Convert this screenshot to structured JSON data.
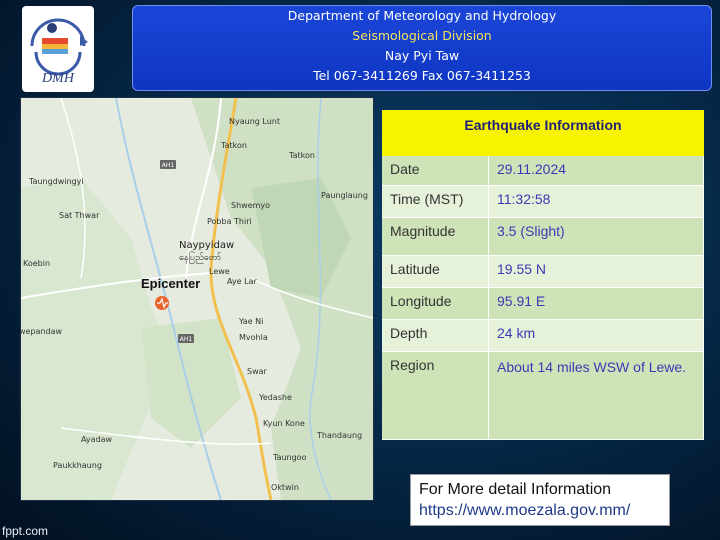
{
  "header": {
    "line1": "Department of Meteorology and Hydrology",
    "line2": "Seismological Division",
    "line3": "Nay Pyi Taw",
    "line4": "Tel 067-3411269 Fax 067-3411253"
  },
  "logo": {
    "text": "DMH"
  },
  "map": {
    "epicenter_label": "Epicenter",
    "places": [
      "Nyaung Lunt",
      "Tatkon",
      "Shwemyo",
      "Tatkon",
      "Paunglaung",
      "Taungdwingyi",
      "Sat Thwar",
      "Pobba Thiri",
      "Naypyidaw",
      "နေပြည်တော်",
      "Lewe",
      "Aye Lar",
      "Koebin",
      "Yae Ni",
      "Mvohla",
      "Swar",
      "Yedashe",
      "Kyun Kone",
      "Thandaung",
      "Taungoo",
      "Oktwin",
      "Ayadaw",
      "Paukkhaung",
      "wepandaw"
    ],
    "roads": [
      "AH1",
      "AH1"
    ]
  },
  "info": {
    "title": "Earthquake Information",
    "rows": [
      {
        "key": "Date",
        "value": "29.11.2024"
      },
      {
        "key": "Time (MST)",
        "value": "11:32:58"
      },
      {
        "key": "Magnitude",
        "value": "3.5 (Slight)"
      },
      {
        "key": "Latitude",
        "value": "19.55 N"
      },
      {
        "key": "Longitude",
        "value": "95.91 E"
      },
      {
        "key": "Depth",
        "value": "24 km"
      },
      {
        "key": "Region",
        "value": "About 14 miles WSW of Lewe."
      }
    ]
  },
  "footer": {
    "label": "For More detail Information",
    "link": "https://www.moezala.gov.mm/"
  },
  "watermark": "fppt.com"
}
